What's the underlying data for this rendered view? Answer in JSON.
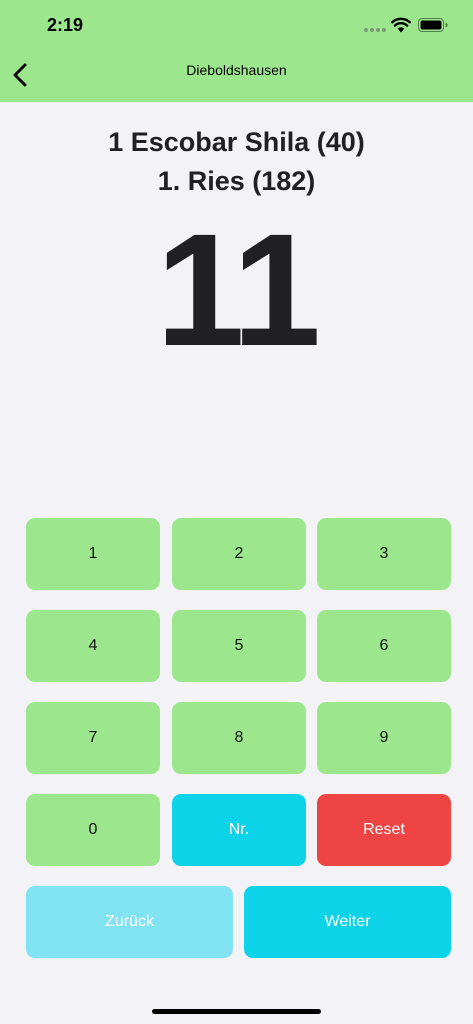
{
  "status_bar": {
    "time": "2:19"
  },
  "nav": {
    "title": "Dieboldshausen"
  },
  "match": {
    "line1": "1 Escobar Shila (40)",
    "line2": "1. Ries (182)"
  },
  "display": {
    "value": "11"
  },
  "keypad": {
    "k1": "1",
    "k2": "2",
    "k3": "3",
    "k4": "4",
    "k5": "5",
    "k6": "6",
    "k7": "7",
    "k8": "8",
    "k9": "9",
    "k0": "0",
    "nr": "Nr.",
    "reset": "Reset",
    "back": "Zurück",
    "next": "Weiter"
  },
  "colors": {
    "header_green": "#9ce78e",
    "key_green": "#9ce78e",
    "cyan": "#0dd3e8",
    "light_cyan": "#81e3f1",
    "red": "#ef4444",
    "background": "#f2f2f7"
  },
  "icons": {
    "back": "chevron-left-icon",
    "wifi": "wifi-icon",
    "battery": "battery-icon",
    "signal": "cellular-signal-icon"
  }
}
